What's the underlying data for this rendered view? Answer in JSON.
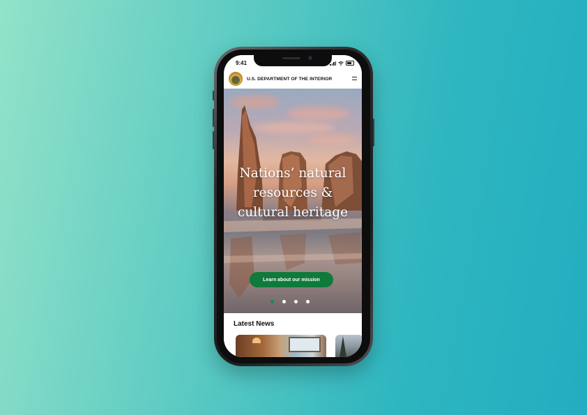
{
  "status_bar": {
    "time": "9:41"
  },
  "header": {
    "agency_name": "U.S. DEPARTMENT OF THE INTERIOR"
  },
  "hero": {
    "headline_lines": [
      "Nations’ natural",
      "resources &",
      "cultural heritage"
    ],
    "cta_label": "Learn about our mission",
    "carousel": {
      "total": 4,
      "active_index": 0
    }
  },
  "news": {
    "title": "Latest News"
  },
  "colors": {
    "brand_green": "#0f7a3a",
    "active_dot": "#1a8a4a",
    "background_left": "#92e2c8",
    "background_right": "#22adc0"
  },
  "icons": {
    "seal": "interior-seal-icon",
    "menu": "hamburger-menu-icon",
    "signal": "cellular-signal-icon",
    "wifi": "wifi-icon",
    "battery": "battery-icon"
  }
}
